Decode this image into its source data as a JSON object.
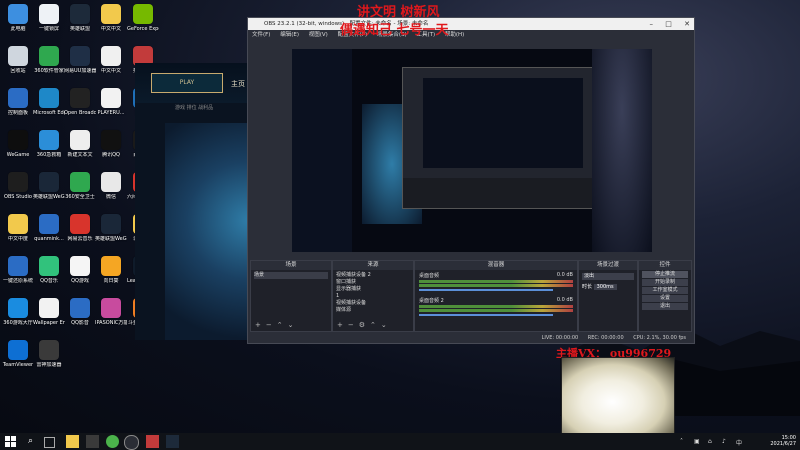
{
  "desktop": {
    "icons": [
      {
        "label": "此电脑",
        "color": "#3d8fe0"
      },
      {
        "label": "一键锁屏",
        "color": "#eef2f6"
      },
      {
        "label": "英雄联盟",
        "color": "#1d2a3a"
      },
      {
        "label": "中文中文",
        "color": "#f2c94c"
      },
      {
        "label": "GeForce Experience",
        "color": "#76b900"
      },
      {
        "label": "回收站",
        "color": "#cfd6de"
      },
      {
        "label": "360软件管家",
        "color": "#2fa84f"
      },
      {
        "label": "网易UU加速器",
        "color": "#1f2f46"
      },
      {
        "label": "中文中文",
        "color": "#f0f0f0"
      },
      {
        "label": "英雄联盟",
        "color": "#c23b3b"
      },
      {
        "label": "控制面板",
        "color": "#2b6cc4"
      },
      {
        "label": "Microsoft Edge",
        "color": "#1e88c8"
      },
      {
        "label": "Open Broadcast...",
        "color": "#222222"
      },
      {
        "label": "PLAYERU...",
        "color": "#f2f2f2"
      },
      {
        "label": "鲁大师",
        "color": "#1f6fb8"
      },
      {
        "label": "WeGame",
        "color": "#0e0e0e"
      },
      {
        "label": "360急救箱",
        "color": "#2b8ed8"
      },
      {
        "label": "新建文本文",
        "color": "#eeeeee"
      },
      {
        "label": "腾讯QQ",
        "color": "#111111"
      },
      {
        "label": "百度网盘",
        "color": "#1a1a1a"
      },
      {
        "label": "OBS Studio",
        "color": "#1e1e1e"
      },
      {
        "label": "英雄联盟WeGame版",
        "color": "#1a2738"
      },
      {
        "label": "360安全卫士",
        "color": "#2fa84f"
      },
      {
        "label": "微信",
        "color": "#e8e8e8"
      },
      {
        "label": "六间房直播伴侣",
        "color": "#d8342c"
      },
      {
        "label": "中文中度",
        "color": "#f2c94c"
      },
      {
        "label": "quanmink...",
        "color": "#2b6cc4"
      },
      {
        "label": "网易云音乐",
        "color": "#d8342c"
      },
      {
        "label": "英雄联盟WeGame版",
        "color": "#1a2738"
      },
      {
        "label": "录屏工具",
        "color": "#f2c94c"
      },
      {
        "label": "一键还原系统",
        "color": "#2b6cc4"
      },
      {
        "label": "QQ音乐",
        "color": "#31c27c"
      },
      {
        "label": "QQ游戏",
        "color": "#f5f5f5"
      },
      {
        "label": "向日葵",
        "color": "#f5a623"
      },
      {
        "label": "League of Legends",
        "color": "#0f1b2a"
      },
      {
        "label": "360游戏大厅",
        "color": "#1a8ce0"
      },
      {
        "label": "Wallpaper Engine",
        "color": "#f2f2f2"
      },
      {
        "label": "QQ影音",
        "color": "#2b6cc4"
      },
      {
        "label": "IPASONIC万能软件",
        "color": "#c84b9e"
      },
      {
        "label": "斗鱼直播伴侣",
        "color": "#ef7d22"
      },
      {
        "label": "TeamViewer",
        "color": "#0e6fd3"
      },
      {
        "label": "雷神加速器",
        "color": "#3a3a3a"
      }
    ]
  },
  "game": {
    "play_label": "PLAY",
    "tab_home": "主页",
    "tab_sub": "游戏 排位 战利品"
  },
  "obs": {
    "title": "OBS 23.2.1 (32-bit, windows) - 配置文件: 未命名 - 场景: 未命名",
    "menu": [
      "文件(F)",
      "编辑(E)",
      "视图(V)",
      "配置文件(P)",
      "场景集合(S)",
      "工具(T)",
      "帮助(H)"
    ],
    "panels": {
      "scenes": {
        "header": "场景",
        "items": [
          "场景"
        ]
      },
      "sources": {
        "header": "来源",
        "items": [
          "视频捕获设备 2",
          "窗口捕获",
          "显示器捕获",
          "1",
          "视频捕获设备",
          "媒体源"
        ]
      },
      "mixer": {
        "header": "混音器",
        "channels": [
          {
            "name": "桌面音频",
            "db": "0.0 dB"
          },
          {
            "name": "桌面音频 2",
            "db": "0.0 dB"
          }
        ]
      },
      "transitions": {
        "header": "场景过渡",
        "type": "淡出",
        "duration_label": "时长",
        "duration": "300ms"
      },
      "controls": {
        "header": "控件",
        "buttons": [
          "停止推流",
          "开始录制",
          "工作室模式",
          "设置",
          "退出"
        ]
      }
    },
    "status": [
      "LIVE: 00:00:00",
      "REC: 00:00:00",
      "CPU: 2.1%, 30.00 fps"
    ]
  },
  "overlay": {
    "line1": "讲文明 树新风",
    "line2": "偶遇知己 七号一天",
    "contact": "主播VX：  ou996729"
  },
  "taskbar": {
    "time": "15:00",
    "date": "2021/6/27"
  }
}
